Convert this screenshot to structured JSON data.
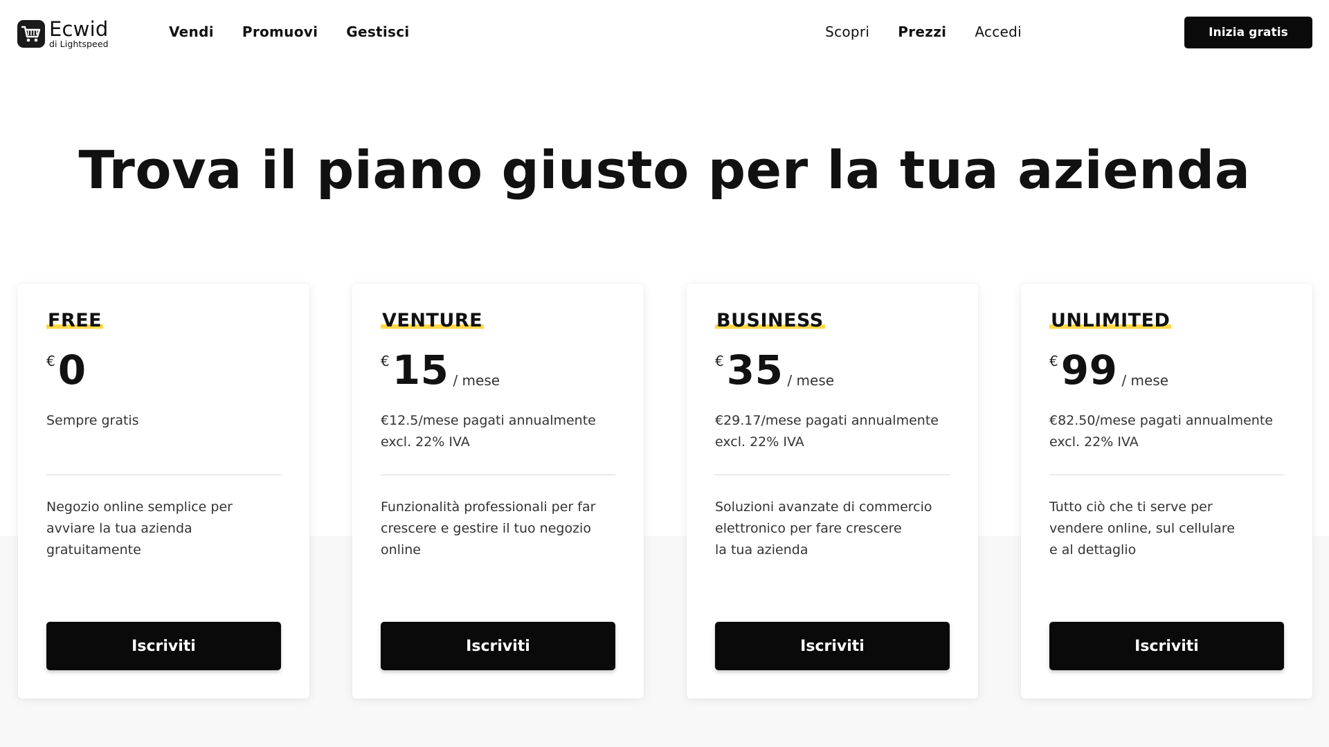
{
  "brand": {
    "name": "Ecwid",
    "sub": "di Lightspeed",
    "icon": "shopping-cart-icon"
  },
  "nav": {
    "left": [
      "Vendi",
      "Promuovi",
      "Gestisci"
    ],
    "right": [
      "Scopri",
      "Prezzi",
      "Accedi"
    ],
    "cta": "Inizia gratis"
  },
  "hero": {
    "title": "Trova il piano giusto per la tua azienda"
  },
  "colors": {
    "accent": "#ffd84a",
    "button": "#0a0a0a"
  },
  "plans": [
    {
      "name": "FREE",
      "currency": "€",
      "amount": "0",
      "period": "",
      "billing": "Sempre gratis",
      "description": "Negozio online semplice per\navviare la tua azienda\ngratuitamente",
      "button": "Iscriviti"
    },
    {
      "name": "VENTURE",
      "currency": "€",
      "amount": "15",
      "period": "/ mese",
      "billing": "€12.5/mese pagati annualmente excl. 22% IVA",
      "description": "Funzionalità professionali per far\ncrescere e gestire il tuo negozio\nonline",
      "button": "Iscriviti"
    },
    {
      "name": "BUSINESS",
      "currency": "€",
      "amount": "35",
      "period": "/ mese",
      "billing": "€29.17/mese pagati annualmente excl. 22% IVA",
      "description": "Soluzioni avanzate di commercio\nelettronico per fare crescere\nla tua azienda",
      "button": "Iscriviti"
    },
    {
      "name": "UNLIMITED",
      "currency": "€",
      "amount": "99",
      "period": "/ mese",
      "billing": "€82.50/mese pagati annualmente excl. 22% IVA",
      "description": "Tutto ciò che ti serve per\nvendere online, sul cellulare\ne al dettaglio",
      "button": "Iscriviti"
    }
  ]
}
